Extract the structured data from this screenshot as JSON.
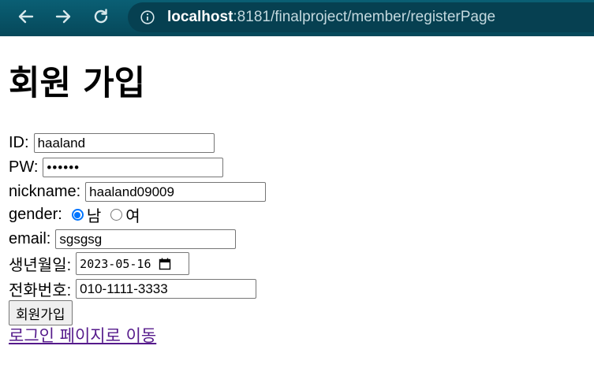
{
  "browser": {
    "url_host": "localhost",
    "url_rest": ":8181/finalproject/member/registerPage"
  },
  "page": {
    "title": "회원 가입"
  },
  "form": {
    "id": {
      "label": "ID:",
      "value": "haaland"
    },
    "pw": {
      "label": "PW:",
      "value": "••••••"
    },
    "nickname": {
      "label": "nickname:",
      "value": "haaland09009"
    },
    "gender": {
      "label": "gender:",
      "options": [
        {
          "label": "남",
          "checked": true
        },
        {
          "label": "여",
          "checked": false
        }
      ]
    },
    "email": {
      "label": "email:",
      "value": "sgsgsg"
    },
    "birth": {
      "label": "생년월일:",
      "value": "2023-05-16"
    },
    "phone": {
      "label": "전화번호:",
      "value": "010-1111-3333"
    },
    "submit_label": "회원가입"
  },
  "links": {
    "login": "로그인 페이지로 이동"
  },
  "colors": {
    "toolbar": "#06485a",
    "radio_checked": "#0075ff",
    "visited_link": "#551a8b"
  }
}
